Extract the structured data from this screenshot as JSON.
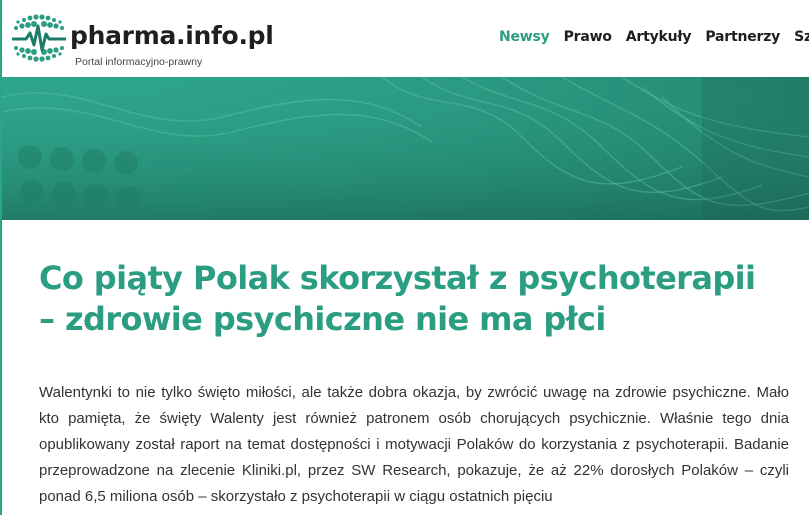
{
  "brand": {
    "name_main": "pharma",
    "name_dot": ".",
    "name_tail": "info.pl",
    "tagline": "Portal informacyjno-prawny"
  },
  "nav": {
    "items": [
      {
        "label": "Newsy"
      },
      {
        "label": "Prawo"
      },
      {
        "label": "Artykuły"
      },
      {
        "label": "Partnerzy"
      },
      {
        "label": "Sz"
      }
    ]
  },
  "article": {
    "title": "Co piąty Polak skorzystał z psychoterapii – zdrowie psychiczne nie ma płci",
    "body": "Walentynki to nie tylko święto miłości, ale także dobra okazja, by zwrócić uwagę na zdrowie psychiczne. Mało kto pamięta, że święty Walenty jest również patronem osób chorujących psychicznie. Właśnie tego dnia opublikowany został raport na temat dostępności i motywacji Polaków do korzystania z psychoterapii. Badanie przeprowadzone na zlecenie Kliniki.pl, przez SW Research, pokazuje, że aż 22% dorosłych Polaków – czyli ponad 6,5 miliona osób – skorzystało z psychoterapii w ciągu ostatnich pięciu"
  },
  "colors": {
    "accent": "#2a9d83",
    "banner": "#2b9f86",
    "text": "#333333"
  }
}
